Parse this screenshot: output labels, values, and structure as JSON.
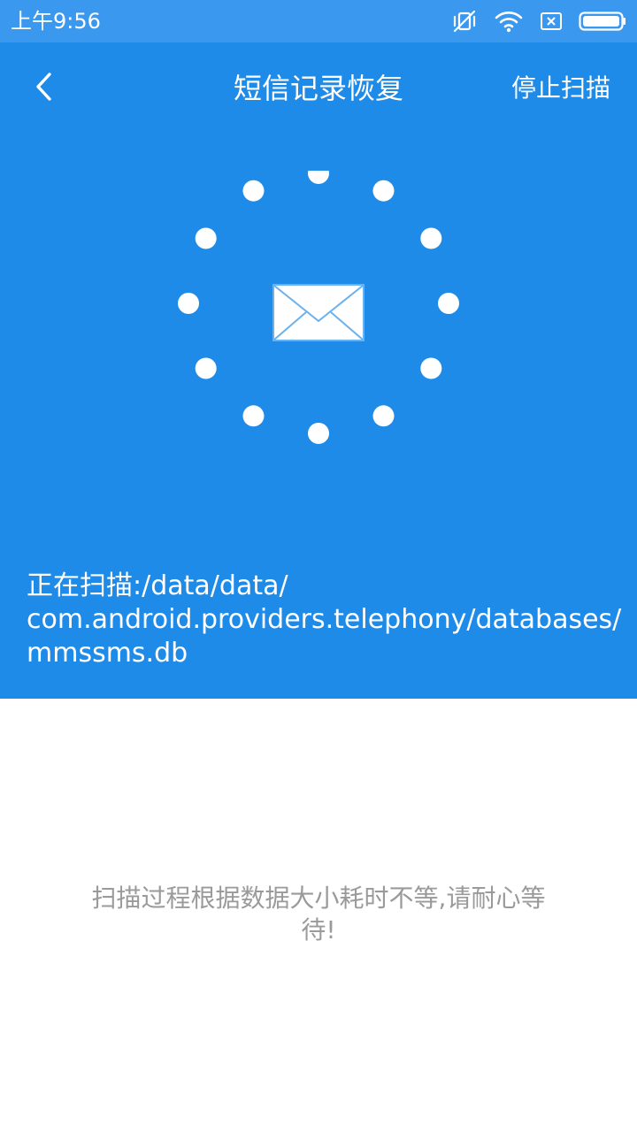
{
  "status_bar": {
    "time": "上午9:56",
    "icons": [
      "silent-vibrate-off-icon",
      "wifi-icon",
      "sim-none-icon",
      "battery-icon"
    ]
  },
  "toolbar": {
    "title": "短信记录恢复",
    "stop_label": "停止扫描",
    "back_icon": "chevron-left-icon"
  },
  "scan": {
    "icon": "envelope-icon",
    "dots_count": 12,
    "path_lines": [
      "正在扫描:/data/data/",
      "com.android.providers.telephony/databases/",
      "mmssms.db"
    ]
  },
  "hint": {
    "lines": [
      "扫描过程根据数据大小耗时不等,请耐心等",
      "待!"
    ]
  },
  "colors": {
    "status_bar_bg": "#3a99ee",
    "header_bg": "#1f8be8",
    "text_on_header": "#ffffff",
    "hint_text": "#9a9a9a",
    "page_bg": "#ffffff"
  }
}
